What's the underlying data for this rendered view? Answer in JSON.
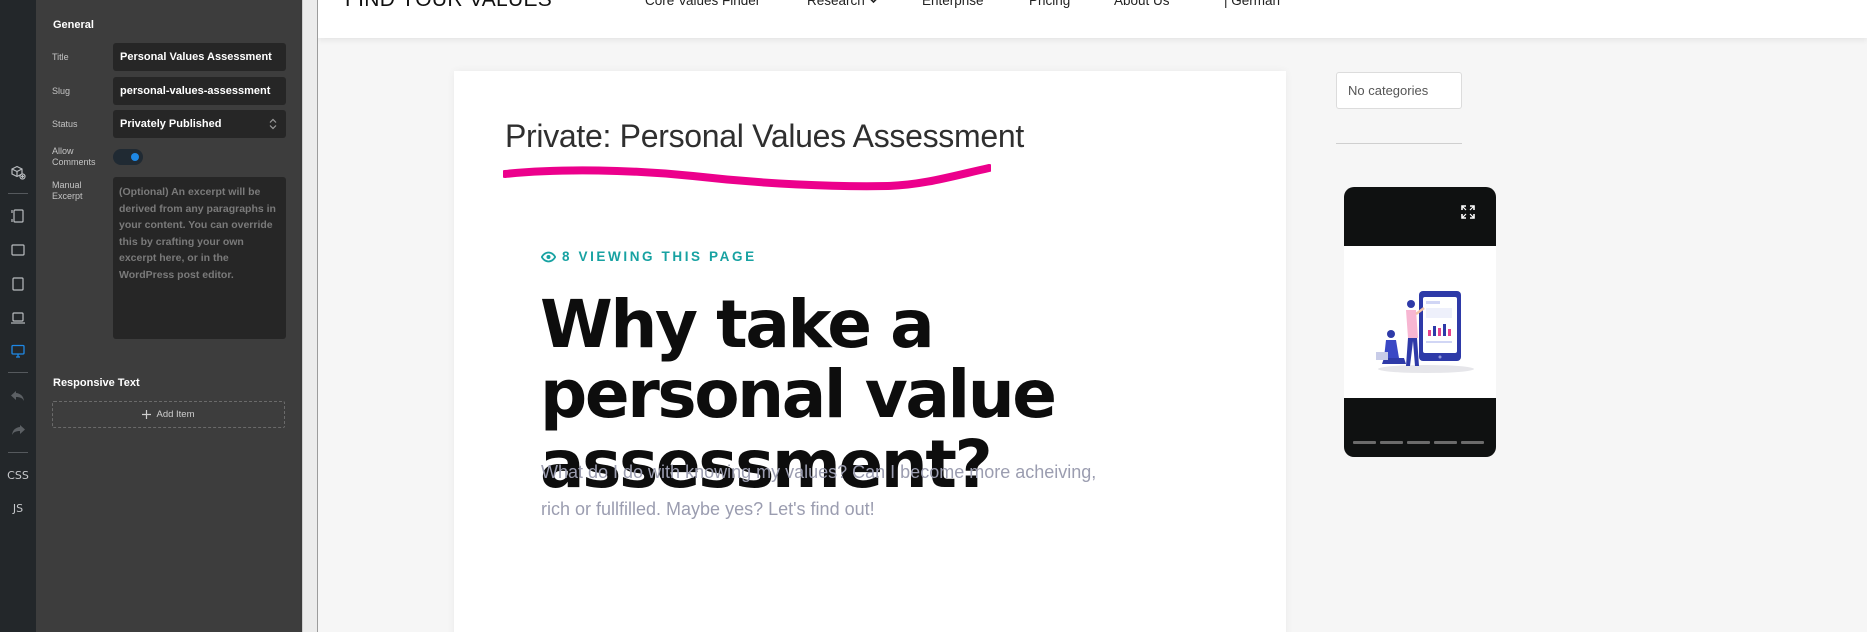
{
  "rail": {
    "css_label": "CSS",
    "js_label": "JS"
  },
  "panel": {
    "general_title": "General",
    "title_label": "Title",
    "title_value": "Personal Values Assessment",
    "slug_label": "Slug",
    "slug_value": "personal-values-assessment",
    "status_label": "Status",
    "status_value": "Privately Published",
    "allow_comments_label_1": "Allow",
    "allow_comments_label_2": "Comments",
    "allow_comments_on": true,
    "manual_excerpt_label_1": "Manual",
    "manual_excerpt_label_2": "Excerpt",
    "excerpt_placeholder": "(Optional) An excerpt will be derived from any paragraphs in your content. You can override this by crafting your own excerpt here, or in the WordPress post editor.",
    "responsive_text_title": "Responsive Text",
    "add_item_label": "Add Item"
  },
  "site": {
    "logo": "FIND YOUR VALUES",
    "nav": [
      "Core Values Finder",
      "Research",
      "Enterprise",
      "Pricing",
      "About Us",
      "| German"
    ]
  },
  "post": {
    "title": "Private: Personal Values Assessment",
    "viewing_text": "8 VIEWING THIS PAGE",
    "headline": "Why take a personal value assessment?",
    "subtext": "What do I do with knowing my values? Can I become more acheiving, rich or fullfilled. Maybe yes? Let's find out!"
  },
  "sidebar": {
    "categories_placeholder": "No categories"
  },
  "colors": {
    "accent_blue": "#1e88e5",
    "highlight_pink": "#ec008c",
    "teal": "#17a2a2"
  }
}
